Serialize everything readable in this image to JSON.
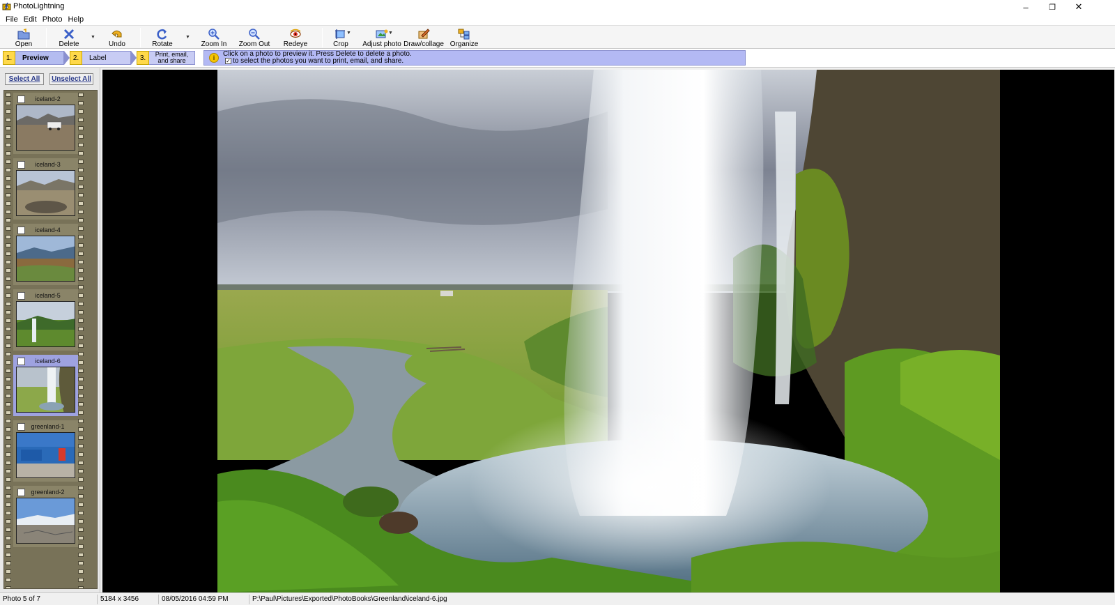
{
  "window": {
    "title": "PhotoLightning",
    "minimize": "–",
    "restore": "❐",
    "close": "✕"
  },
  "menu": {
    "file": "File",
    "edit": "Edit",
    "photo": "Photo",
    "help": "Help"
  },
  "toolbar": {
    "open": "Open",
    "delete": "Delete",
    "undo": "Undo",
    "rotate": "Rotate",
    "zoom_in": "Zoom In",
    "zoom_out": "Zoom Out",
    "redeye": "Redeye",
    "crop": "Crop",
    "adjust_photo": "Adjust photo",
    "draw_collage": "Draw/collage",
    "organize": "Organize",
    "dropdown_glyph": "▼"
  },
  "steps": {
    "step1_num": "1.",
    "step1_label": "Preview",
    "step2_num": "2.",
    "step2_label": "Label",
    "step3_num": "3.",
    "step3_label_line1": "Print, email,",
    "step3_label_line2": "and share"
  },
  "hint": {
    "icon": "i",
    "line1": "Click on a photo to preview it.  Press Delete to delete a photo.",
    "check_glyph": "✓",
    "line2": "to select the photos you want to print, email, and share."
  },
  "filmstrip": {
    "select_all": "Select All",
    "unselect_all": "Unselect All",
    "items": [
      {
        "name": "iceland-2"
      },
      {
        "name": "iceland-3"
      },
      {
        "name": "iceland-4"
      },
      {
        "name": "iceland-5"
      },
      {
        "name": "iceland-6"
      },
      {
        "name": "greenland-1"
      },
      {
        "name": "greenland-2"
      }
    ],
    "selected_index": 4
  },
  "status": {
    "photo_index": "Photo 5 of 7",
    "dimensions": "5184 x 3456",
    "datetime": "08/05/2016  04:59 PM",
    "path": "P:\\Paul\\Pictures\\Exported\\PhotoBooks\\Greenland\\iceland-6.jpg"
  },
  "colors": {
    "step_number": "#ffd94a",
    "step_body": "#c8ccf4",
    "hint_bg": "#b3b9f4",
    "filmstrip_bg": "#787258",
    "selected_frame": "#9ea2e0",
    "viewer_bg": "#000000"
  }
}
